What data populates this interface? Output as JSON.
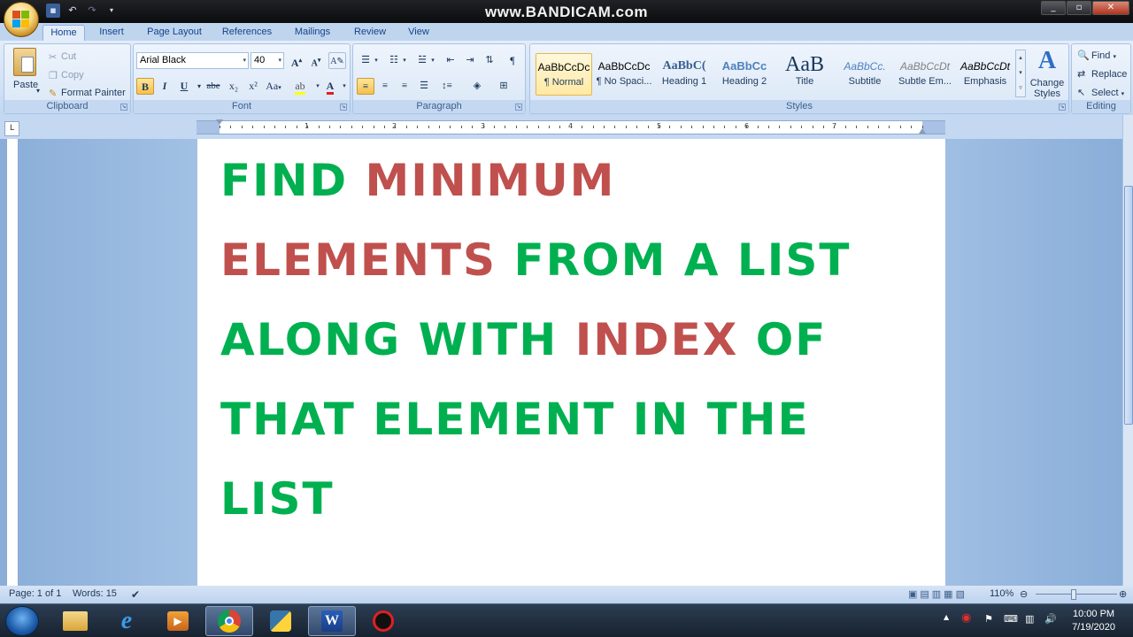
{
  "window": {
    "watermark": "www.BANDICAM.com"
  },
  "tabs": [
    {
      "label": "Home"
    },
    {
      "label": "Insert"
    },
    {
      "label": "Page Layout"
    },
    {
      "label": "References"
    },
    {
      "label": "Mailings"
    },
    {
      "label": "Review"
    },
    {
      "label": "View"
    }
  ],
  "clipboard": {
    "group_label": "Clipboard",
    "paste": "Paste",
    "cut": "Cut",
    "copy": "Copy",
    "format_painter": "Format Painter"
  },
  "font": {
    "group_label": "Font",
    "name": "Arial Black",
    "size": "40",
    "bold": "B",
    "italic": "I",
    "underline": "U",
    "strike": "abe",
    "sub": "x₂",
    "sup": "x²",
    "case": "Aa",
    "grow": "A",
    "shrink": "A"
  },
  "paragraph": {
    "group_label": "Paragraph"
  },
  "styles": {
    "group_label": "Styles",
    "items": [
      {
        "preview": "AaBbCcDc",
        "name": "¶ Normal"
      },
      {
        "preview": "AaBbCcDc",
        "name": "¶ No Spaci..."
      },
      {
        "preview": "AaBbC(",
        "name": "Heading 1"
      },
      {
        "preview": "AaBbCc",
        "name": "Heading 2"
      },
      {
        "preview": "AaB",
        "name": "Title"
      },
      {
        "preview": "AaBbCc.",
        "name": "Subtitle"
      },
      {
        "preview": "AaBbCcDt",
        "name": "Subtle Em..."
      },
      {
        "preview": "AaBbCcDt",
        "name": "Emphasis"
      }
    ],
    "change_styles": "Change Styles"
  },
  "editing": {
    "group_label": "Editing",
    "find": "Find",
    "replace": "Replace",
    "select": "Select"
  },
  "ruler": {
    "numbers": [
      "1",
      "2",
      "3",
      "4",
      "5",
      "6",
      "7"
    ]
  },
  "document": {
    "lines": [
      [
        {
          "t": "FIND ",
          "c": "g"
        },
        {
          "t": "MINIMUM",
          "c": "r"
        }
      ],
      [
        {
          "t": "ELEMENTS ",
          "c": "r"
        },
        {
          "t": "FROM A LIST",
          "c": "g"
        }
      ],
      [
        {
          "t": "ALONG WITH ",
          "c": "g"
        },
        {
          "t": "INDEX",
          "c": "r"
        },
        {
          "t": " OF",
          "c": "g"
        }
      ],
      [
        {
          "t": "THAT ELEMENT IN THE",
          "c": "g"
        }
      ],
      [
        {
          "t": "LIST",
          "c": "g"
        }
      ]
    ],
    "colors": {
      "green": "#00b050",
      "red": "#c0504d"
    }
  },
  "status": {
    "page": "Page: 1 of 1",
    "words": "Words: 15",
    "zoom": "110%"
  },
  "taskbar": {
    "time": "10:00 PM",
    "date": "7/19/2020"
  }
}
